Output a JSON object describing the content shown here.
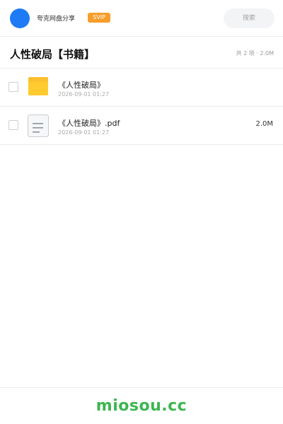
{
  "header": {
    "app_name": "夸克网盘分享",
    "badge": "SVIP",
    "search_placeholder": "搜索",
    "avatar_color": "#1e7bf5",
    "badge_color": "#f79d2b"
  },
  "folder": {
    "title": "人性破局【书籍】",
    "summary": "共 2 项 · 2.0M"
  },
  "files": [
    {
      "name": "《人性破局》",
      "date": "2026-09-01 01:27",
      "size": "",
      "icon": "folder-icon",
      "checked": false
    },
    {
      "name": "《人性破局》.pdf",
      "date": "2026-09-01 01:27",
      "size": "2.0M",
      "icon": "document-icon",
      "checked": false
    }
  ],
  "footer": {
    "watermark": "miosou.cc",
    "watermark_color": "#3cb651"
  }
}
